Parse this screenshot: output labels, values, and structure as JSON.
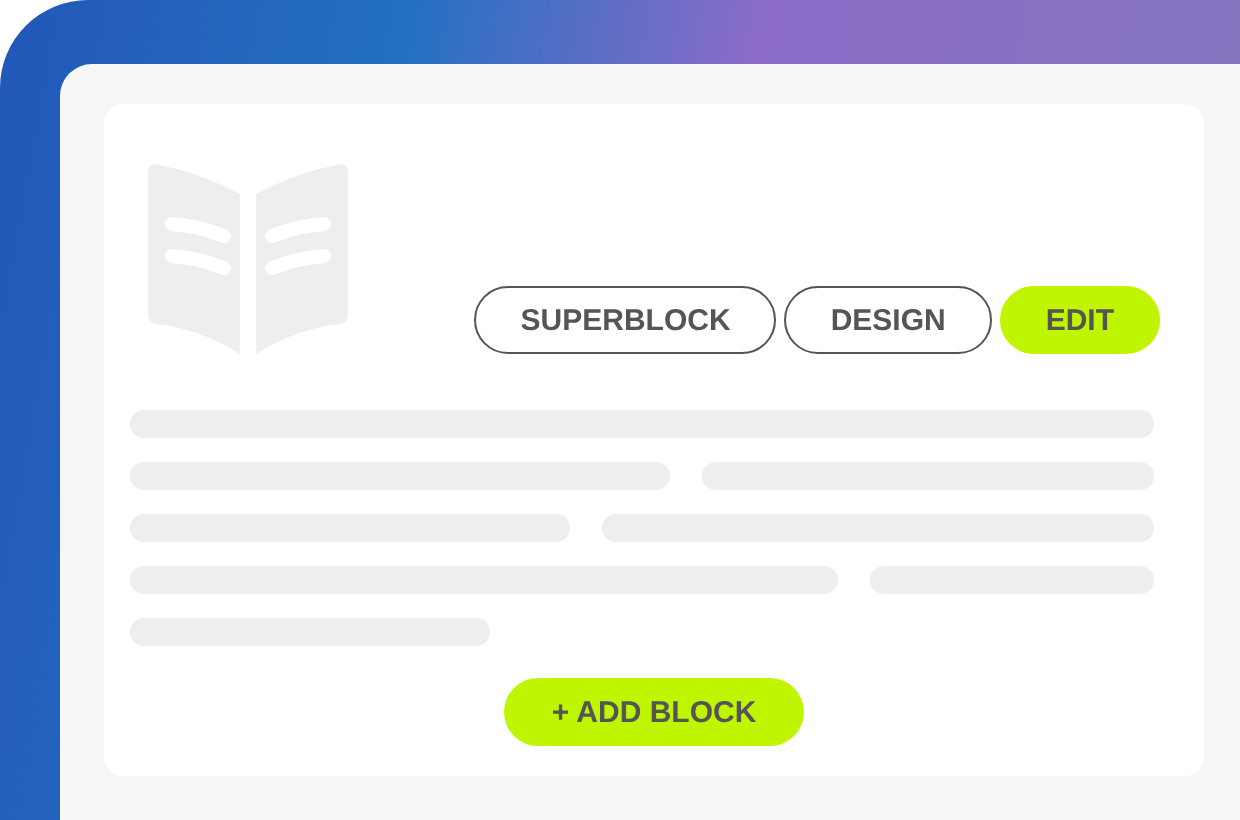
{
  "tabs": [
    {
      "label": "SUPERBLOCK",
      "selected": false
    },
    {
      "label": "DESIGN",
      "selected": false
    },
    {
      "label": "EDIT",
      "selected": true
    }
  ],
  "add_button": {
    "label": "+ ADD BLOCK"
  }
}
